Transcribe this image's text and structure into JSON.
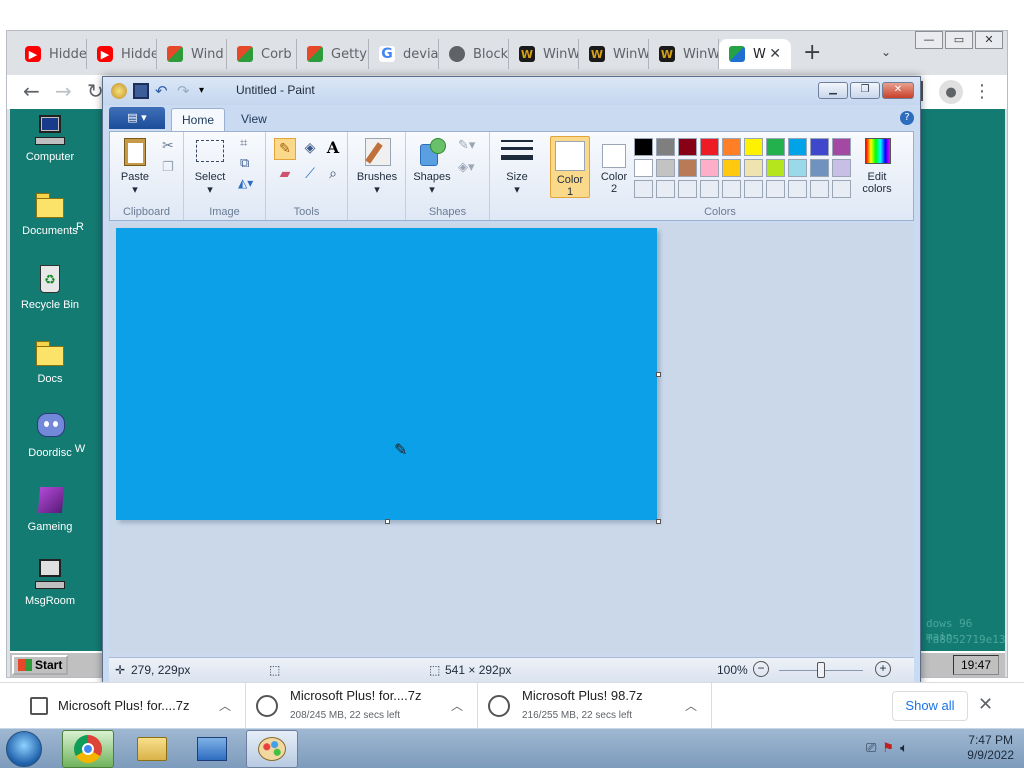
{
  "browser": {
    "tabs": [
      {
        "label": "Hidde",
        "favicon": "youtube-icon"
      },
      {
        "label": "Hidde",
        "favicon": "youtube-icon"
      },
      {
        "label": "Wind",
        "favicon": "windows-icon"
      },
      {
        "label": "Corb",
        "favicon": "windows-icon"
      },
      {
        "label": "Getty",
        "favicon": "windows-icon"
      },
      {
        "label": "devia",
        "favicon": "google-icon"
      },
      {
        "label": "Block",
        "favicon": "globe-icon"
      },
      {
        "label": "WinW",
        "favicon": "w-icon"
      },
      {
        "label": "WinW",
        "favicon": "w-icon"
      },
      {
        "label": "WinW",
        "favicon": "w-icon"
      },
      {
        "label": "W",
        "favicon": "grid-icon"
      }
    ],
    "new_tab": "+",
    "close": "✕"
  },
  "desktop": {
    "icons": [
      {
        "label": "Computer"
      },
      {
        "label": "Documents"
      },
      {
        "label": "Recycle Bin"
      },
      {
        "label": "Docs"
      },
      {
        "label": "Doordisc"
      },
      {
        "label": "Gameing"
      },
      {
        "label": "MsgRoom"
      }
    ],
    "partial_labels": [
      "R",
      "W"
    ],
    "watermark": [
      "dows 96 main",
      "fa8052719e13"
    ],
    "start_label": "Start",
    "clock": "19:47"
  },
  "paint": {
    "title": "Untitled - Paint",
    "tabs": {
      "home": "Home",
      "view": "View"
    },
    "groups": {
      "clipboard": "Clipboard",
      "image": "Image",
      "tools": "Tools",
      "shapes": "Shapes",
      "colors": "Colors"
    },
    "buttons": {
      "paste": "Paste",
      "select": "Select",
      "brushes": "Brushes",
      "shapes": "Shapes",
      "size": "Size",
      "color1": "Color 1",
      "color2": "Color 2",
      "edit_colors": "Edit colors"
    },
    "palette_row1": [
      "#000000",
      "#7f7f7f",
      "#880015",
      "#ed1c24",
      "#ff7f27",
      "#fff200",
      "#22b14c",
      "#00a2e8",
      "#3f48cc",
      "#a349a4"
    ],
    "palette_row2": [
      "#ffffff",
      "#c3c3c3",
      "#b97a57",
      "#ffaec9",
      "#ffc90e",
      "#efe4b0",
      "#b5e61d",
      "#99d9ea",
      "#7092be",
      "#c8bfe7"
    ],
    "canvas_color": "#0ca0e8",
    "status": {
      "cursor_pos": "279, 229px",
      "canvas_size": "541 × 292px",
      "zoom": "100%"
    }
  },
  "downloads": {
    "items": [
      {
        "name": "Microsoft Plus! for....7z",
        "sub": ""
      },
      {
        "name": "Microsoft Plus! for....7z",
        "sub": "208/245 MB, 22 secs left"
      },
      {
        "name": "Microsoft Plus! 98.7z",
        "sub": "216/255 MB, 22 secs left"
      }
    ],
    "show_all": "Show all"
  },
  "taskbar": {
    "time": "7:47 PM",
    "date": "9/9/2022"
  }
}
